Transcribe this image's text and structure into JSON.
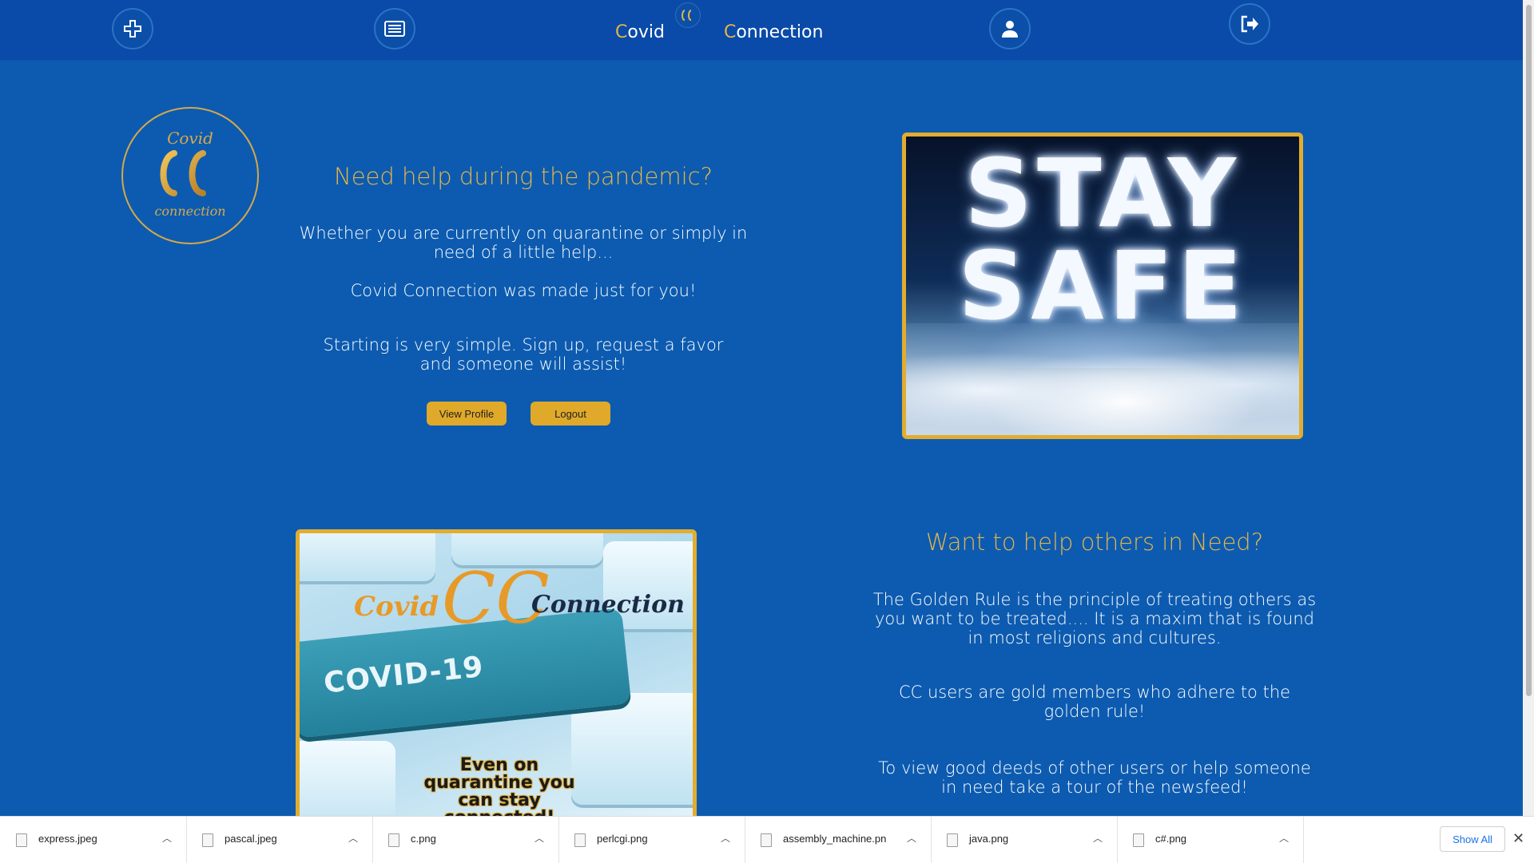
{
  "nav": {
    "brand_first_initial": "C",
    "brand_first_rest": "ovid",
    "brand_second_initial": "C",
    "brand_second_rest": "onnection",
    "icons": [
      "plus-icon",
      "newsfeed-icon",
      "user-icon",
      "logout-icon"
    ]
  },
  "hero": {
    "heading": "Need help during the pandemic?",
    "para1": "Whether you are currently on quarantine or simply in need of a little help...",
    "para2": "Covid Connection was made just for you!",
    "para3": "Starting is very simple. Sign up, request a favor and someone will assist!",
    "view_profile_label": "View Profile",
    "logout_label": "Logout"
  },
  "logo": {
    "top_text": "Covid",
    "monogram": "CC",
    "bottom_text": "connection"
  },
  "stay_safe": {
    "line1": "STAY",
    "line2": "SAFE"
  },
  "help_section": {
    "heading": "Want to help others in Need?",
    "para1": "The Golden Rule is the principle of treating others as you want to be treated.... It is a maxim that is found in most religions and cultures.",
    "para2": "CC users are gold members who adhere to the golden rule!",
    "para3": "To view good deeds of other users or help someone in need take a tour of the newsfeed!"
  },
  "covid_image": {
    "brand_covid": "Covid",
    "brand_cc": "CC",
    "brand_connection": "Connection",
    "key_label": "COVID-19",
    "caption": "Even on quarantine you can stay connected!"
  },
  "downloads": {
    "items": [
      "express.jpeg",
      "pascal.jpeg",
      "c.png",
      "perlcgi.png",
      "assembly_machine.pn",
      "java.png",
      "c#.png"
    ],
    "show_all": "Show All",
    "close": "✕"
  },
  "colors": {
    "page_bg": "#0c5bb0",
    "navbar_bg": "#0a4aa8",
    "gold": "#e3b54a",
    "button_gold": "#e0a929"
  }
}
